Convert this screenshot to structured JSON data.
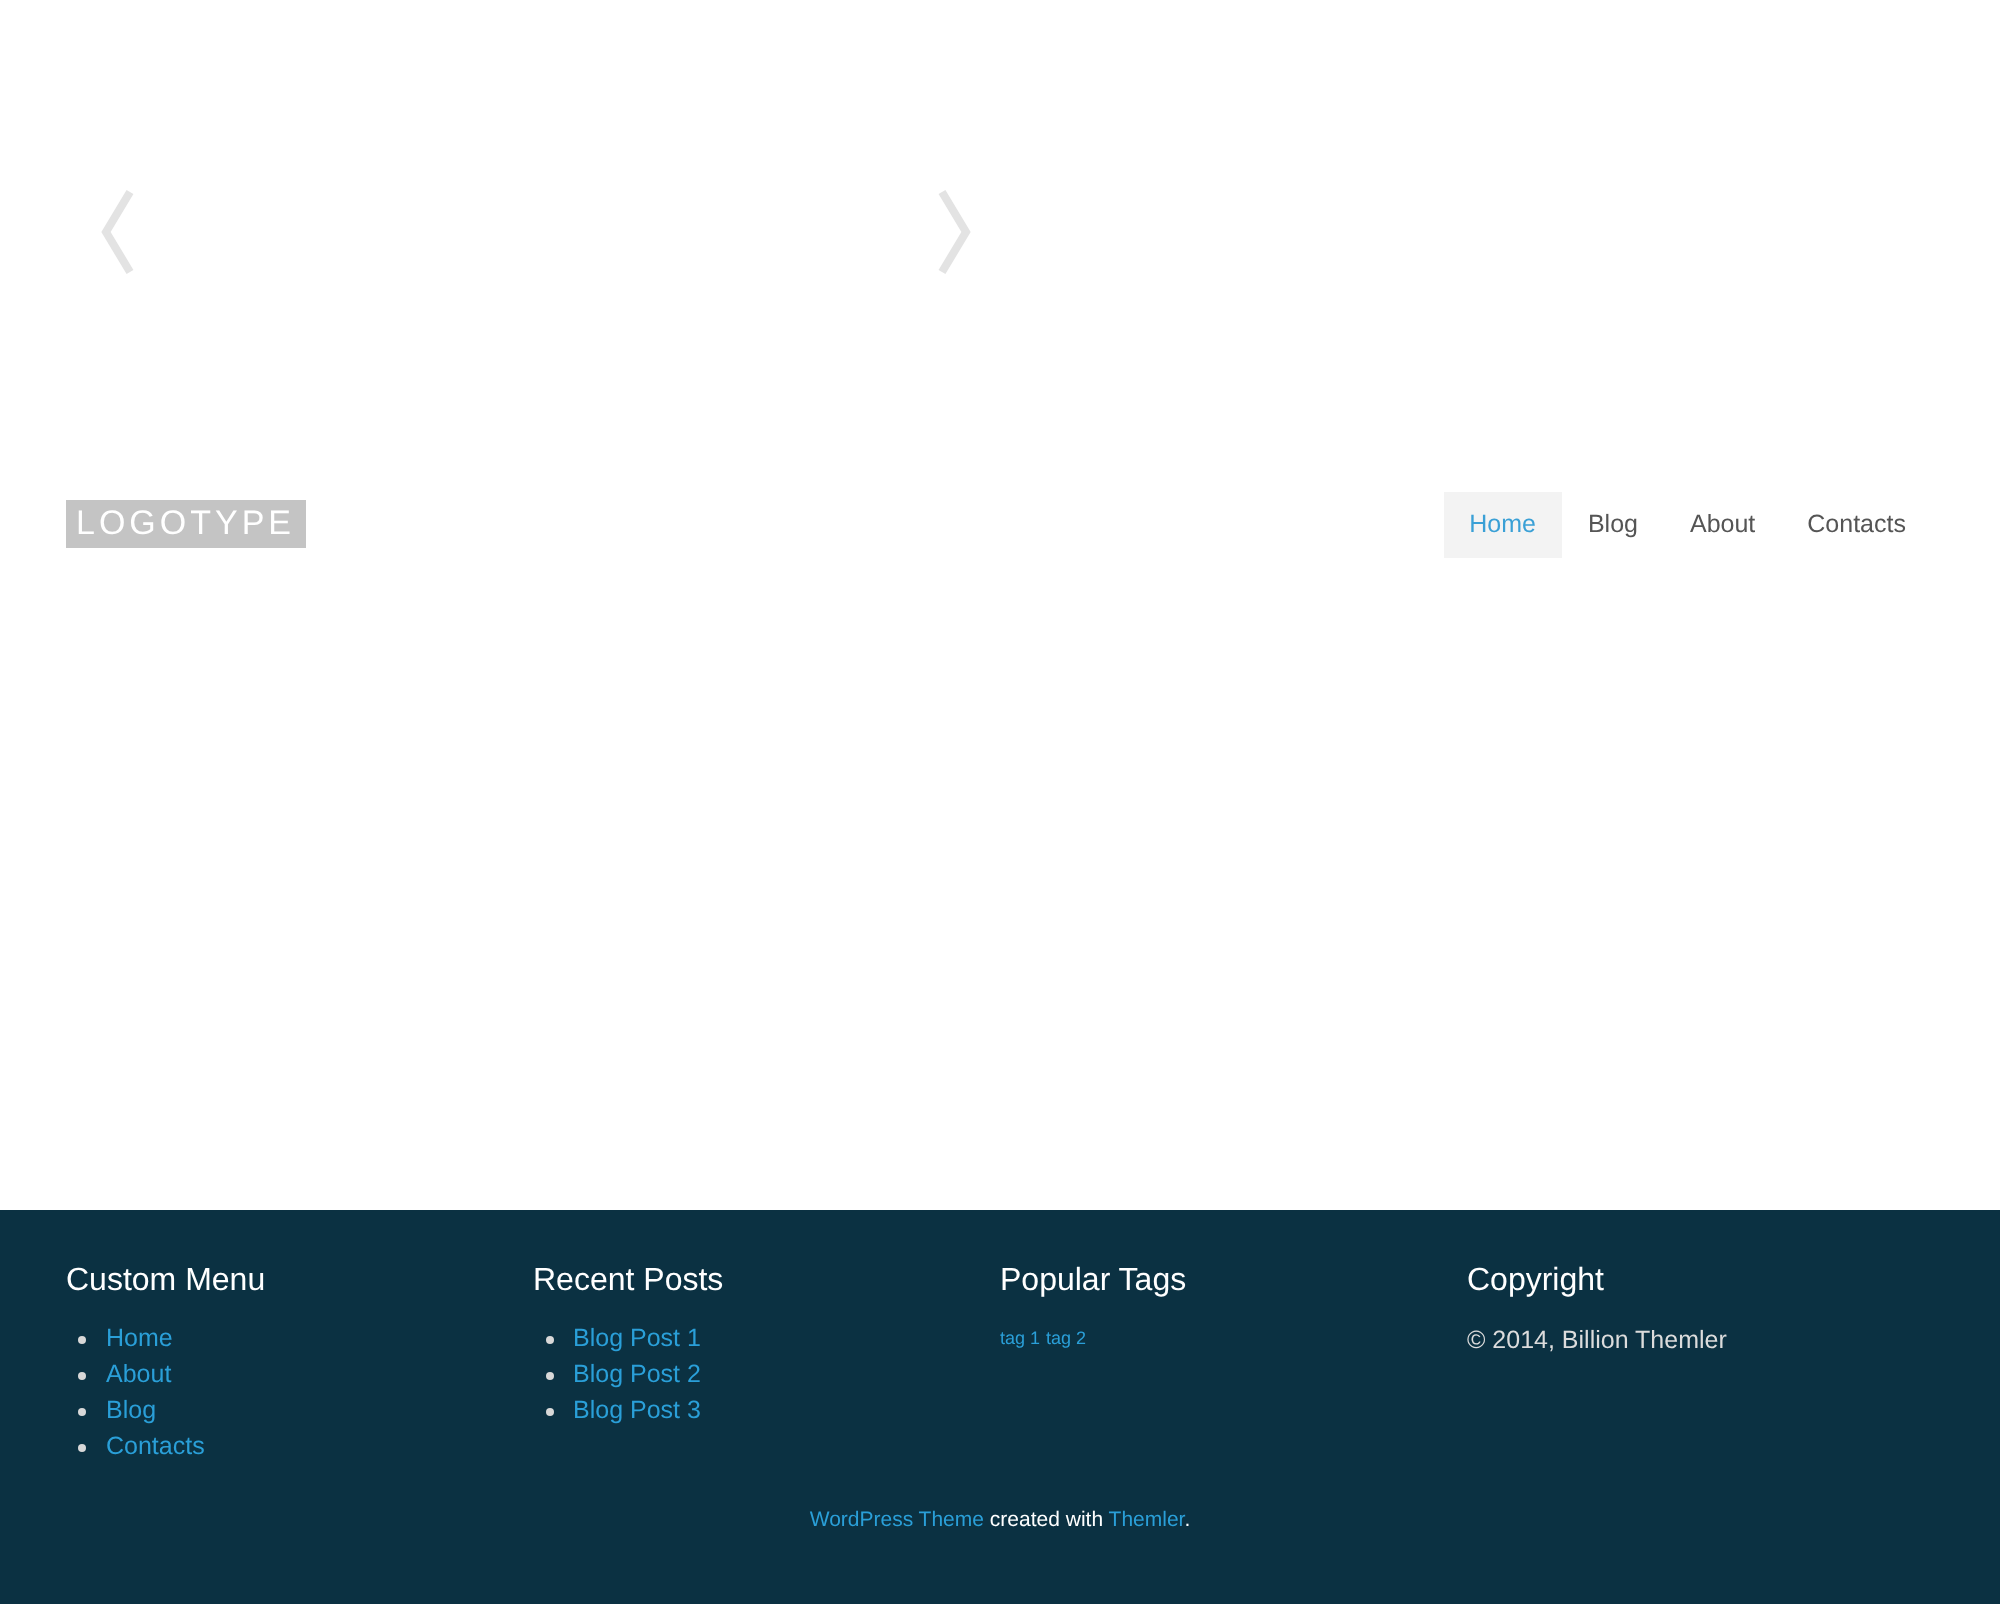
{
  "header": {
    "logo": "LOGOTYPE",
    "nav": [
      {
        "label": "Home",
        "selected": true
      },
      {
        "label": "Blog",
        "selected": false
      },
      {
        "label": "About",
        "selected": false
      },
      {
        "label": "Contacts",
        "selected": false
      }
    ]
  },
  "footer": {
    "widgets": [
      {
        "kind": "list",
        "title": "Custom Menu",
        "items": [
          "Home",
          "About",
          "Blog",
          "Contacts"
        ]
      },
      {
        "kind": "list",
        "title": "Recent Posts",
        "items": [
          "Blog Post 1",
          "Blog Post 2",
          "Blog Post 3"
        ]
      },
      {
        "kind": "tags",
        "title": "Popular Tags",
        "items": [
          "tag 1",
          "tag 2"
        ]
      },
      {
        "kind": "text",
        "title": "Copyright",
        "text": "© 2014, Billion Themler"
      }
    ],
    "credit": {
      "link_1": "WordPress Theme",
      "middle": "created with",
      "link_2": "Themler",
      "end": "."
    }
  }
}
